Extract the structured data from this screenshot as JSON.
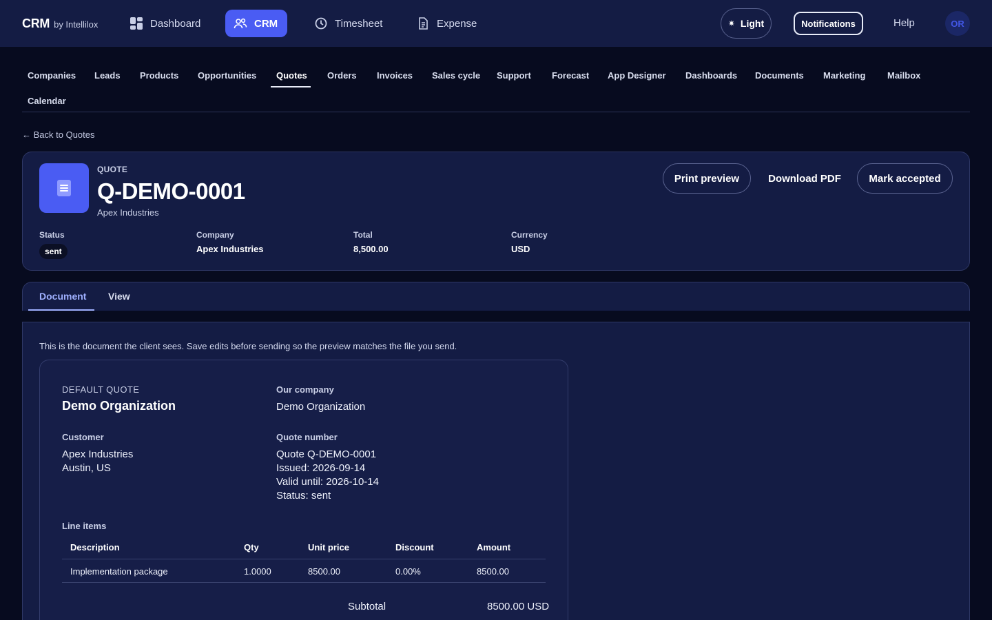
{
  "brand": {
    "name": "CRM",
    "by": "by Intellilox"
  },
  "topnav": {
    "items": [
      {
        "label": "Dashboard",
        "icon": "dashboard-grid-icon"
      },
      {
        "label": "CRM",
        "icon": "users-icon"
      },
      {
        "label": "Timesheet",
        "icon": "clock-icon"
      },
      {
        "label": "Expense",
        "icon": "document-icon"
      }
    ],
    "active": "CRM",
    "theme_label": "Light",
    "notifications_label": "Notifications",
    "help_label": "Help",
    "avatar_initials": "OR"
  },
  "subnav": {
    "items": [
      "Companies",
      "Leads",
      "Products",
      "Opportunities",
      "Quotes",
      "Orders",
      "Invoices",
      "Sales cycle",
      "Support",
      "Forecast",
      "App Designer",
      "Dashboards",
      "Documents",
      "Marketing",
      "Mailbox",
      "Calendar"
    ],
    "active": "Quotes"
  },
  "back_link": "← Back to Quotes",
  "quote": {
    "eyebrow": "QUOTE",
    "number": "Q-DEMO-0001",
    "company": "Apex Industries",
    "actions": {
      "print_preview": "Print preview",
      "download_pdf": "Download PDF",
      "mark_accepted": "Mark accepted"
    },
    "meta": {
      "status_label": "Status",
      "status_value": "sent",
      "company_label": "Company",
      "company_value": "Apex Industries",
      "total_label": "Total",
      "total_value": "8,500.00",
      "currency_label": "Currency",
      "currency_value": "USD"
    }
  },
  "tabs": {
    "items": [
      "Document",
      "View"
    ],
    "active": "Document"
  },
  "document": {
    "note": "This is the document the client sees. Save edits before sending so the preview matches the file you send.",
    "template_label": "DEFAULT QUOTE",
    "org_name": "Demo Organization",
    "our_company_label": "Our company",
    "our_company_value": "Demo Organization",
    "customer_label": "Customer",
    "customer_name": "Apex Industries",
    "customer_location": "Austin, US",
    "quote_number_label": "Quote number",
    "quote_line": "Quote Q-DEMO-0001",
    "issued_line": "Issued: 2026-09-14",
    "valid_line": "Valid until: 2026-10-14",
    "status_line": "Status: sent",
    "line_items_label": "Line items",
    "line_items": {
      "headers": [
        "Description",
        "Qty",
        "Unit price",
        "Discount",
        "Amount"
      ],
      "rows": [
        [
          "Implementation package",
          "1.0000",
          "8500.00",
          "0.00%",
          "8500.00"
        ]
      ]
    },
    "subtotal_label": "Subtotal",
    "subtotal_value": "8500.00 USD"
  },
  "colors": {
    "accent": "#4a5cf3",
    "topbar_bg": "#141c44",
    "page_bg": "#070b1f",
    "tab_active": "#9fb0ff"
  }
}
